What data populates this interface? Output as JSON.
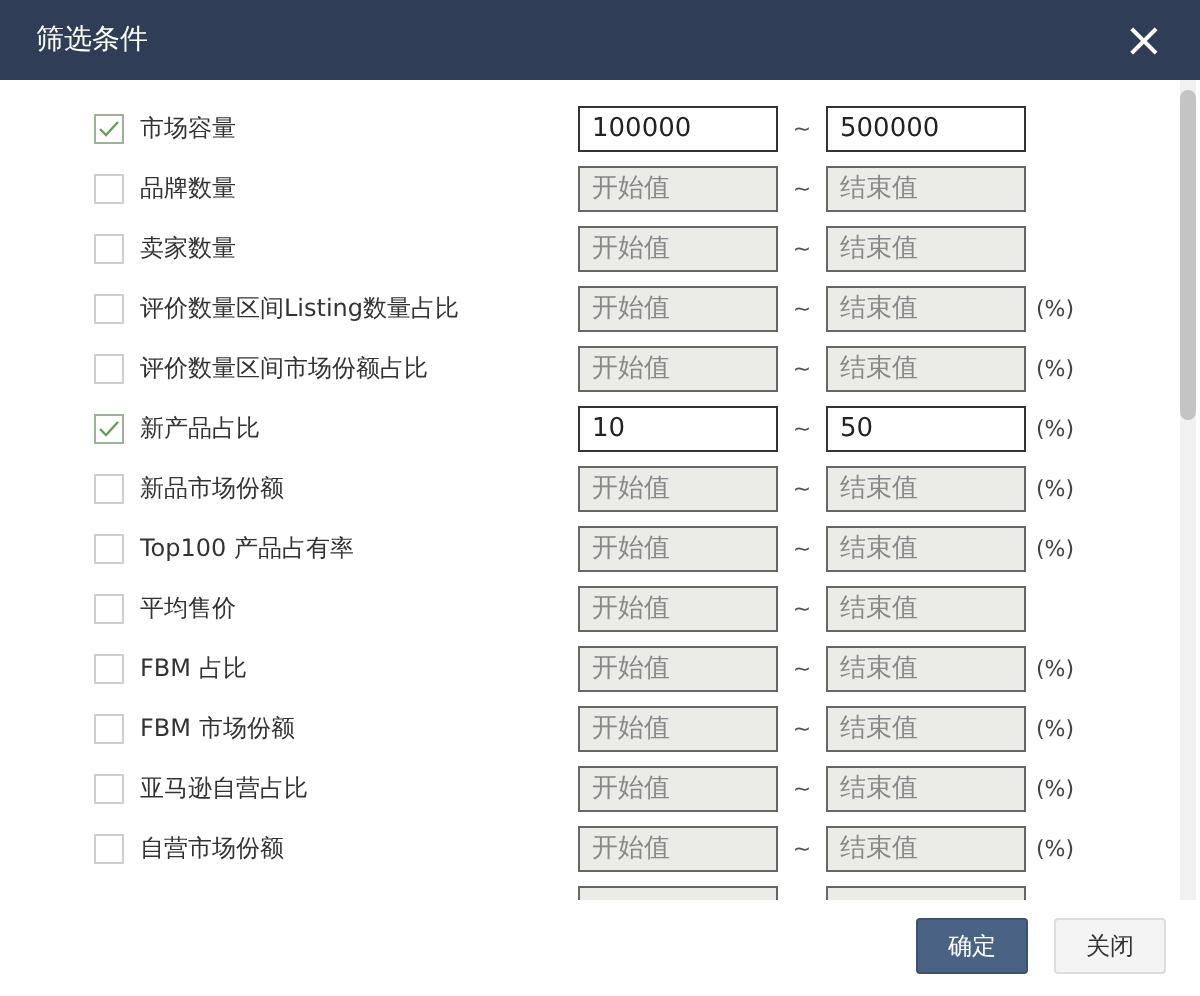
{
  "window": {
    "title": "筛选条件",
    "close": "×"
  },
  "filters": [
    {
      "kind": "row",
      "label": "市场容量",
      "checked": true,
      "from": {
        "value": "100000"
      },
      "sep": "~",
      "to": {
        "value": "500000"
      }
    },
    {
      "kind": "row",
      "label": "品牌数量",
      "checked": false,
      "from": {
        "placeholder": "开始值"
      },
      "sep": "~",
      "to": {
        "placeholder": "结束值"
      }
    },
    {
      "kind": "row",
      "label": "卖家数量",
      "checked": false,
      "from": {
        "placeholder": "开始值"
      },
      "sep": "~",
      "to": {
        "placeholder": "结束值"
      }
    },
    {
      "kind": "row",
      "label": "评价数量区间Listing数量占比",
      "checked": false,
      "from": {
        "placeholder": "开始值"
      },
      "sep": "~",
      "to": {
        "placeholder": "结束值"
      },
      "unit": "(%)"
    },
    {
      "kind": "row",
      "label": "评价数量区间市场份额占比",
      "checked": false,
      "from": {
        "placeholder": "开始值"
      },
      "sep": "~",
      "to": {
        "placeholder": "结束值"
      },
      "unit": "(%)"
    },
    {
      "kind": "row",
      "label": "新产品占比",
      "checked": true,
      "from": {
        "value": "10"
      },
      "sep": "~",
      "to": {
        "value": "50"
      },
      "unit": "(%)"
    },
    {
      "kind": "row",
      "label": "新品市场份额",
      "checked": false,
      "from": {
        "placeholder": "开始值"
      },
      "sep": "~",
      "to": {
        "placeholder": "结束值"
      },
      "unit": "(%)"
    },
    {
      "kind": "row",
      "label": "Top100 产品占有率",
      "checked": false,
      "from": {
        "placeholder": "开始值"
      },
      "sep": "~",
      "to": {
        "placeholder": "结束值"
      },
      "unit": "(%)"
    },
    {
      "kind": "row",
      "label": "平均售价",
      "checked": false,
      "from": {
        "placeholder": "开始值"
      },
      "sep": "~",
      "to": {
        "placeholder": "结束值"
      }
    },
    {
      "kind": "row",
      "label": "FBM 占比",
      "checked": false,
      "from": {
        "placeholder": "开始值"
      },
      "sep": "~",
      "to": {
        "placeholder": "结束值"
      },
      "unit": "(%)"
    },
    {
      "kind": "row",
      "label": "FBM 市场份额",
      "checked": false,
      "from": {
        "placeholder": "开始值"
      },
      "sep": "~",
      "to": {
        "placeholder": "结束值"
      },
      "unit": "(%)"
    },
    {
      "kind": "row",
      "label": "亚马逊自营占比",
      "checked": false,
      "from": {
        "placeholder": "开始值"
      },
      "sep": "~",
      "to": {
        "placeholder": "结束值"
      },
      "unit": "(%)"
    },
    {
      "kind": "row",
      "label": "自营市场份额",
      "checked": false,
      "from": {
        "placeholder": "开始值"
      },
      "sep": "~",
      "to": {
        "placeholder": "结束值"
      },
      "unit": "(%)"
    },
    {
      "kind": "partial"
    }
  ],
  "buttons": [
    {
      "label": "确定",
      "kind": "primary"
    },
    {
      "label": "关闭",
      "kind": "secondary"
    }
  ]
}
